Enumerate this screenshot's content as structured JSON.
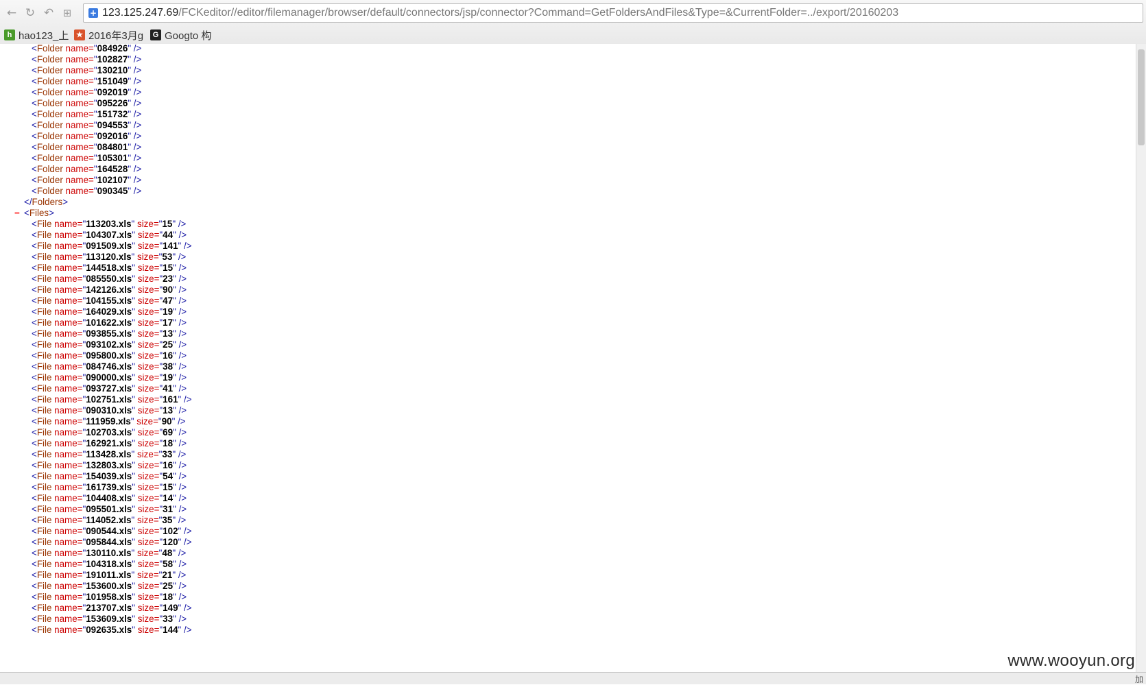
{
  "browser": {
    "url_host": "123.125.247.69",
    "url_path": "/FCKeditor//editor/filemanager/browser/default/connectors/jsp/connector?Command=GetFoldersAndFiles&Type=&CurrentFolder=../export/20160203",
    "nav_icons": [
      "back-icon",
      "reload-icon",
      "undo-icon",
      "grid-icon"
    ],
    "bookmarks": [
      {
        "label": "hao123_上",
        "icon": "hao123-icon",
        "color": "#4a9a2a"
      },
      {
        "label": "2016年3月g",
        "icon": "bookmark-star-icon",
        "color": "#d9532b"
      },
      {
        "label": "Googto 构",
        "icon": "google-g-icon",
        "color": "#222222"
      }
    ]
  },
  "xml": {
    "folder_tag": "Folder",
    "file_tag": "File",
    "name_attr": "name",
    "size_attr": "size",
    "folders_close": "Folders",
    "files_open": "Files",
    "collapse_symbol": "−",
    "folders": [
      "084926",
      "102827",
      "130210",
      "151049",
      "092019",
      "095226",
      "151732",
      "094553",
      "092016",
      "084801",
      "105301",
      "164528",
      "102107",
      "090345"
    ],
    "files": [
      {
        "name": "113203.xls",
        "size": "15"
      },
      {
        "name": "104307.xls",
        "size": "44"
      },
      {
        "name": "091509.xls",
        "size": "141"
      },
      {
        "name": "113120.xls",
        "size": "53"
      },
      {
        "name": "144518.xls",
        "size": "15"
      },
      {
        "name": "085550.xls",
        "size": "23"
      },
      {
        "name": "142126.xls",
        "size": "90"
      },
      {
        "name": "104155.xls",
        "size": "47"
      },
      {
        "name": "164029.xls",
        "size": "19"
      },
      {
        "name": "101622.xls",
        "size": "17"
      },
      {
        "name": "093855.xls",
        "size": "13"
      },
      {
        "name": "093102.xls",
        "size": "25"
      },
      {
        "name": "095800.xls",
        "size": "16"
      },
      {
        "name": "084746.xls",
        "size": "38"
      },
      {
        "name": "090000.xls",
        "size": "19"
      },
      {
        "name": "093727.xls",
        "size": "41"
      },
      {
        "name": "102751.xls",
        "size": "161"
      },
      {
        "name": "090310.xls",
        "size": "13"
      },
      {
        "name": "111959.xls",
        "size": "90"
      },
      {
        "name": "102703.xls",
        "size": "69"
      },
      {
        "name": "162921.xls",
        "size": "18"
      },
      {
        "name": "113428.xls",
        "size": "33"
      },
      {
        "name": "132803.xls",
        "size": "16"
      },
      {
        "name": "154039.xls",
        "size": "54"
      },
      {
        "name": "161739.xls",
        "size": "15"
      },
      {
        "name": "104408.xls",
        "size": "14"
      },
      {
        "name": "095501.xls",
        "size": "31"
      },
      {
        "name": "114052.xls",
        "size": "35"
      },
      {
        "name": "090544.xls",
        "size": "102"
      },
      {
        "name": "095844.xls",
        "size": "120"
      },
      {
        "name": "130110.xls",
        "size": "48"
      },
      {
        "name": "104318.xls",
        "size": "58"
      },
      {
        "name": "191011.xls",
        "size": "21"
      },
      {
        "name": "153600.xls",
        "size": "25"
      },
      {
        "name": "101958.xls",
        "size": "18"
      },
      {
        "name": "213707.xls",
        "size": "149"
      },
      {
        "name": "153609.xls",
        "size": "33"
      },
      {
        "name": "092635.xls",
        "size": "144"
      }
    ]
  },
  "status": {
    "right_text": "加"
  },
  "watermark": "www.wooyun.org"
}
